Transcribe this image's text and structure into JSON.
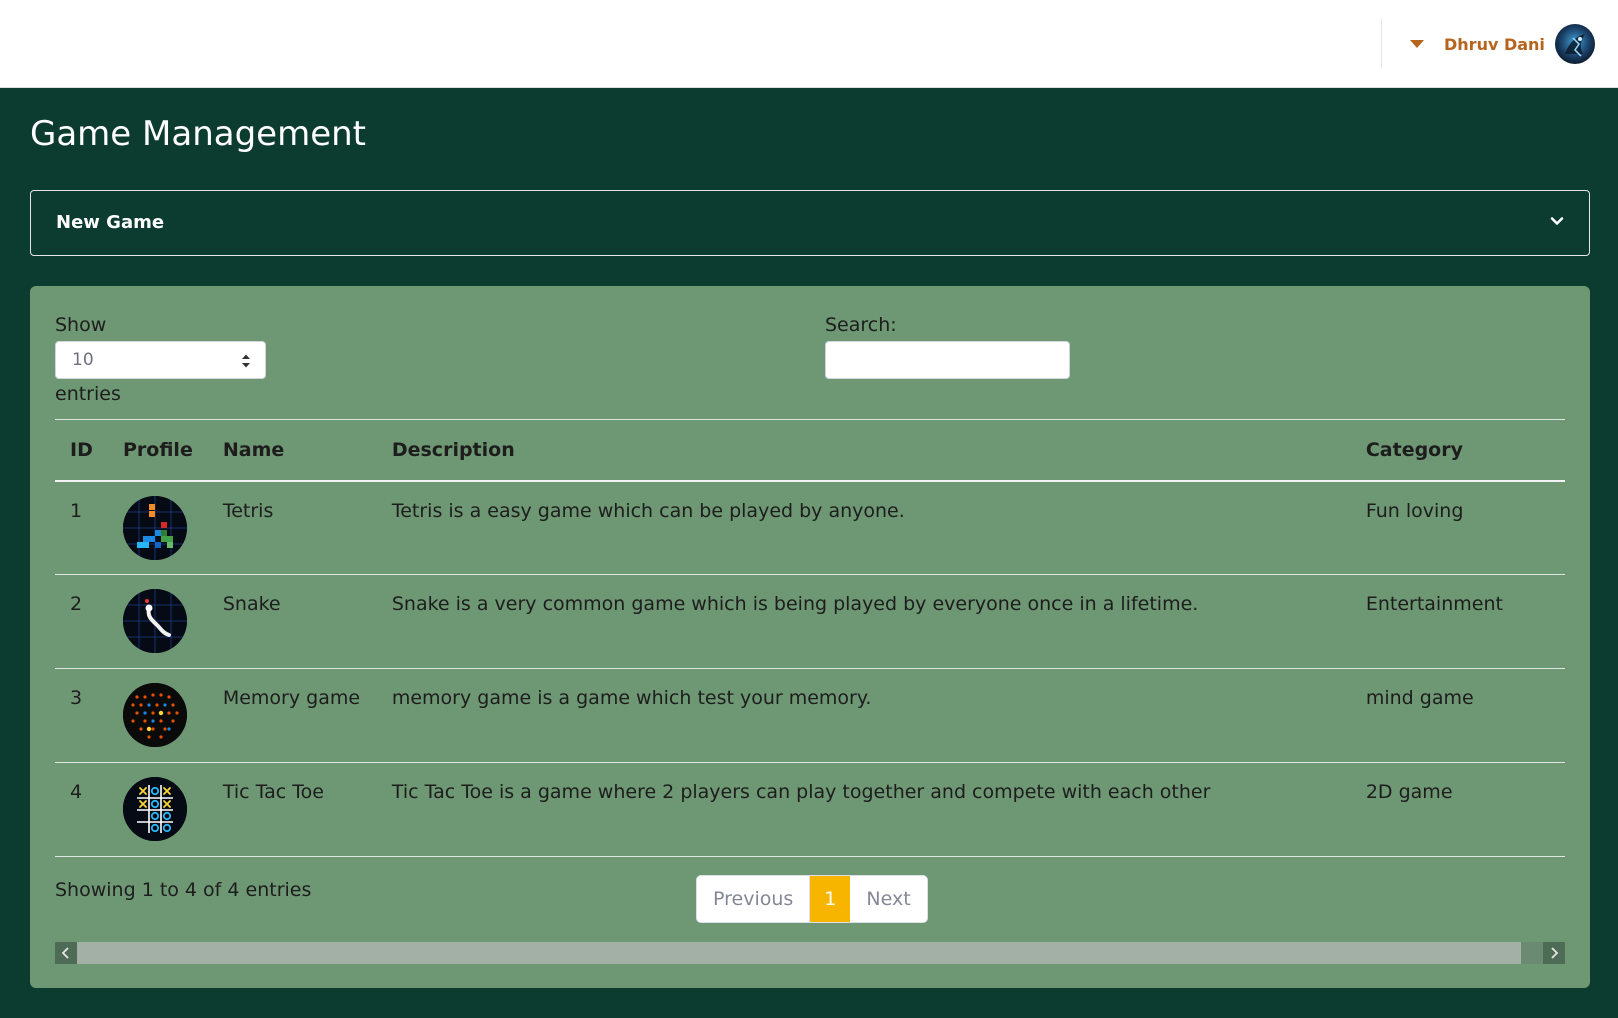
{
  "header": {
    "user_name": "Dhruv Dani"
  },
  "page": {
    "title": "Game Management"
  },
  "new_game": {
    "label": "New Game"
  },
  "table_controls": {
    "show_label": "Show",
    "page_length": "10",
    "entries_label": "entries",
    "search_label": "Search:",
    "search_value": ""
  },
  "table": {
    "columns": [
      "ID",
      "Profile",
      "Name",
      "Description",
      "Category"
    ],
    "rows": [
      {
        "id": "1",
        "profile_icon": "tetris-icon",
        "name": "Tetris",
        "description": "Tetris is a easy game which can be played by anyone.",
        "category": "Fun loving"
      },
      {
        "id": "2",
        "profile_icon": "snake-icon",
        "name": "Snake",
        "description": "Snake is a very common game which is being played by everyone once in a lifetime.",
        "category": "Entertainment"
      },
      {
        "id": "3",
        "profile_icon": "memory-game-icon",
        "name": "Memory game",
        "description": "memory game is a game which test your memory.",
        "category": "mind game"
      },
      {
        "id": "4",
        "profile_icon": "tic-tac-toe-icon",
        "name": "Tic Tac Toe",
        "description": "Tic Tac Toe is a game where 2 players can play together and compete with each other",
        "category": "2D game"
      }
    ]
  },
  "footer": {
    "info": "Showing 1 to 4 of 4 entries",
    "pagination": {
      "previous": "Previous",
      "current": "1",
      "next": "Next"
    }
  },
  "colors": {
    "background": "#0c3b30",
    "card": "#6e9774",
    "accent": "#f7b500",
    "username": "#b5651d"
  }
}
